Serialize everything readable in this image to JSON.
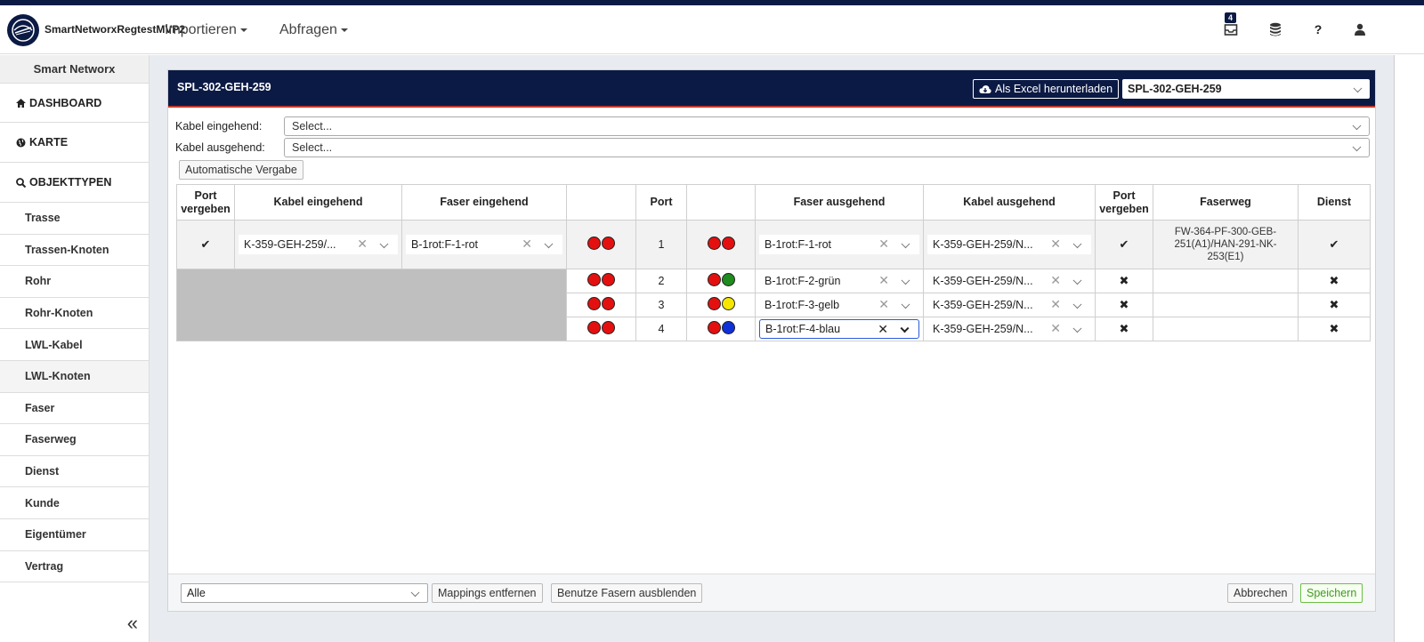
{
  "app": {
    "brand": "SmartNetworxRegtestMVP2",
    "menus": [
      "Importieren",
      "Abfragen"
    ],
    "notification_count": "4"
  },
  "sidebar": {
    "header": "Smart Networx",
    "sections": [
      "DASHBOARD",
      "KARTE",
      "OBJEKTTYPEN"
    ],
    "items": [
      "Trasse",
      "Trassen-Knoten",
      "Rohr",
      "Rohr-Knoten",
      "LWL-Kabel",
      "LWL-Knoten",
      "Faser",
      "Faserweg",
      "Dienst",
      "Kunde",
      "Eigentümer",
      "Vertrag"
    ],
    "active_item": "LWL-Knoten",
    "collapse": "«"
  },
  "panel": {
    "title": "SPL-302-GEH-259",
    "excel_button": "Als Excel herunterladen",
    "selected_object": "SPL-302-GEH-259"
  },
  "filters": {
    "incoming_label": "Kabel eingehend:",
    "incoming_value": "Select...",
    "outgoing_label": "Kabel ausgehend:",
    "outgoing_value": "Select...",
    "auto_button": "Automatische Vergabe"
  },
  "table": {
    "headers": {
      "port_assigned_in": "Port vergeben",
      "cable_in": "Kabel eingehend",
      "fiber_in": "Faser eingehend",
      "port": "Port",
      "fiber_out": "Faser ausgehend",
      "cable_out": "Kabel ausgehend",
      "port_assigned_out": "Port vergeben",
      "fiberpath": "Faserweg",
      "service": "Dienst"
    },
    "rows": [
      {
        "port": "1",
        "fiber_out": "B-1rot:F-1-rot",
        "cable_out": "K-359-GEH-259/N...",
        "assigned_out": "✔",
        "fiberpath": "FW-364-PF-300-GEB-251(A1)/HAN-291-NK-253(E1)",
        "service": "✔",
        "assigned_in": "✔",
        "cable_in": "K-359-GEH-259/...",
        "fiber_in": "B-1rot:F-1-rot",
        "colors_in": [
          "#e41010",
          "#e41010"
        ],
        "colors_out": [
          "#e41010",
          "#e41010"
        ]
      },
      {
        "port": "2",
        "fiber_out": "B-1rot:F-2-grün",
        "cable_out": "K-359-GEH-259/N...",
        "assigned_out": "✖",
        "fiberpath": "",
        "service": "✖",
        "colors_in": [
          "#e41010",
          "#e41010"
        ],
        "colors_out": [
          "#e41010",
          "#1e8c1e"
        ]
      },
      {
        "port": "3",
        "fiber_out": "B-1rot:F-3-gelb",
        "cable_out": "K-359-GEH-259/N...",
        "assigned_out": "✖",
        "fiberpath": "",
        "service": "✖",
        "colors_in": [
          "#e41010",
          "#e41010"
        ],
        "colors_out": [
          "#e41010",
          "#f5e600"
        ]
      },
      {
        "port": "4",
        "fiber_out": "B-1rot:F-4-blau",
        "cable_out": "K-359-GEH-259/N...",
        "assigned_out": "✖",
        "fiberpath": "",
        "service": "✖",
        "colors_in": [
          "#e41010",
          "#e41010"
        ],
        "colors_out": [
          "#e41010",
          "#1030d8"
        ]
      }
    ]
  },
  "footer": {
    "filter_value": "Alle",
    "remove_button": "Mappings entfernen",
    "hide_button": "Benutze Fasern ausblenden",
    "cancel_button": "Abbrechen",
    "save_button": "Speichern"
  }
}
